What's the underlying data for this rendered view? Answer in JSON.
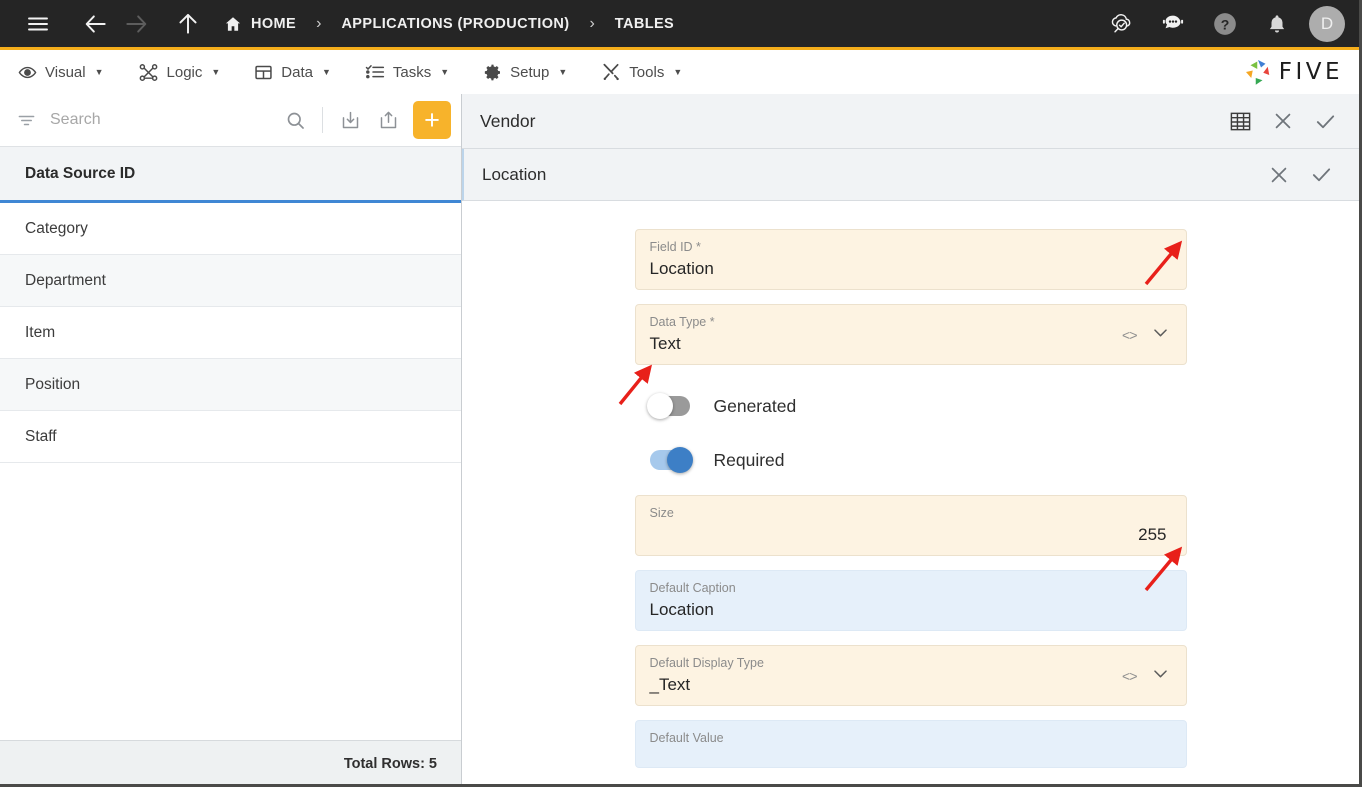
{
  "topbar": {
    "menu_icon": "hamburger-icon",
    "back_icon": "arrow-left-icon",
    "forward_icon": "arrow-right-icon",
    "up_icon": "arrow-up-icon",
    "breadcrumbs": [
      {
        "label": "HOME",
        "icon": "home-icon"
      },
      {
        "label": "APPLICATIONS (PRODUCTION)",
        "icon": ""
      },
      {
        "label": "TABLES",
        "icon": ""
      }
    ],
    "separator": "›",
    "actions": [
      {
        "name": "cloud-search-icon"
      },
      {
        "name": "chatbot-icon"
      },
      {
        "name": "help-icon"
      },
      {
        "name": "notifications-bell-icon"
      }
    ],
    "avatar_initial": "D"
  },
  "menubar": {
    "items": [
      {
        "label": "Visual",
        "icon": "eye-icon"
      },
      {
        "label": "Logic",
        "icon": "nodes-icon"
      },
      {
        "label": "Data",
        "icon": "table-icon"
      },
      {
        "label": "Tasks",
        "icon": "checklist-icon"
      },
      {
        "label": "Setup",
        "icon": "gear-icon"
      },
      {
        "label": "Tools",
        "icon": "tools-icon"
      }
    ],
    "caret": "▼",
    "brand": "FIVE",
    "accent_color": "#f5ae1b"
  },
  "sidebar": {
    "search": {
      "placeholder": "Search",
      "value": ""
    },
    "toolbar": {
      "filter_icon": "filter-icon",
      "search_icon": "search-icon",
      "import_icon": "import-icon",
      "export_icon": "export-icon",
      "add_label": "+"
    },
    "column_header": "Data Source ID",
    "rows": [
      {
        "label": "Category"
      },
      {
        "label": "Department"
      },
      {
        "label": "Item"
      },
      {
        "label": "Position"
      },
      {
        "label": "Staff"
      }
    ],
    "status": "Total Rows: 5"
  },
  "main": {
    "panel": {
      "title": "Vendor",
      "actions": [
        {
          "name": "grid-view-icon"
        },
        {
          "name": "close-icon"
        },
        {
          "name": "confirm-icon"
        }
      ]
    },
    "subpanel": {
      "title": "Location",
      "actions": [
        {
          "name": "close-icon"
        },
        {
          "name": "confirm-icon"
        }
      ]
    },
    "fields": [
      {
        "label": "Field ID *",
        "value": "Location",
        "style": "cream",
        "align": "left",
        "icons": []
      },
      {
        "label": "Data Type *",
        "value": "Text",
        "style": "cream",
        "align": "left",
        "icons": [
          "code-icon",
          "chevron-down-icon"
        ]
      },
      {
        "label": "Size",
        "value": "255",
        "style": "cream",
        "align": "right",
        "icons": []
      },
      {
        "label": "Default Caption",
        "value": "Location",
        "style": "blue",
        "align": "left",
        "icons": []
      },
      {
        "label": "Default Display Type",
        "value": "_Text",
        "style": "cream",
        "align": "left",
        "icons": [
          "code-icon",
          "chevron-down-icon"
        ]
      },
      {
        "label": "Default Value",
        "value": "",
        "style": "blue",
        "align": "left",
        "icons": []
      }
    ],
    "toggles": [
      {
        "label": "Generated",
        "state": "off"
      },
      {
        "label": "Required",
        "state": "on"
      }
    ]
  },
  "annotations": {
    "color": "#e8201a",
    "arrows": [
      {
        "name": "annotation-arrow-data-type"
      },
      {
        "name": "annotation-arrow-required-toggle"
      },
      {
        "name": "annotation-arrow-display-type"
      }
    ]
  }
}
